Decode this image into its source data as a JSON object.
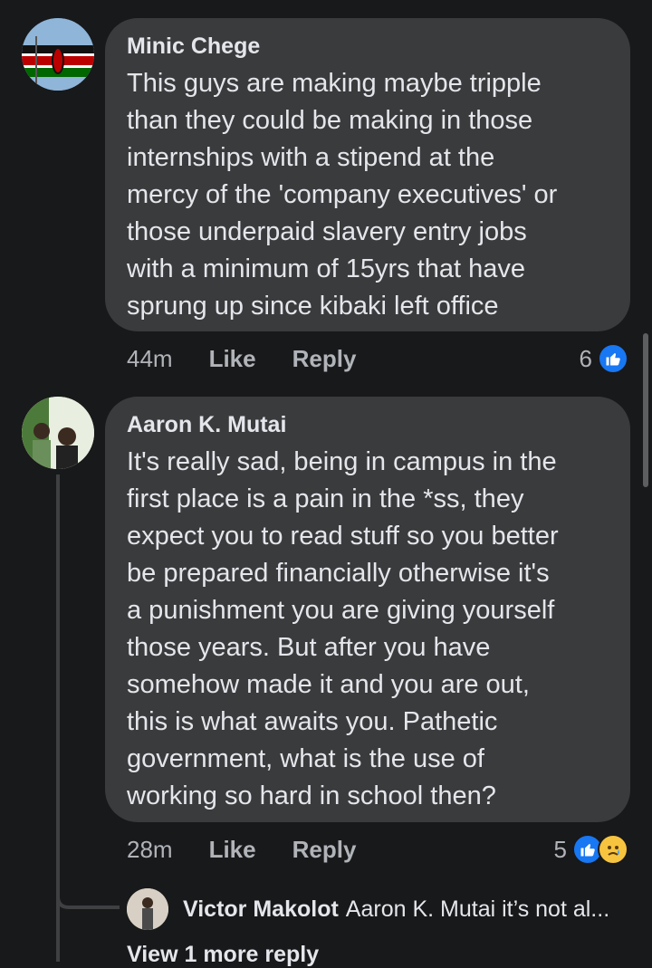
{
  "comments": [
    {
      "author": "Minic Chege",
      "text": "This guys are making maybe tripple\nthan they could be making in those\ninternships with a stipend at the\nmercy of the 'company executives' or\nthose underpaid slavery entry jobs\nwith a minimum of 15yrs that have\nsprung up since kibaki left office",
      "time": "44m",
      "like_label": "Like",
      "reply_label": "Reply",
      "reaction_count": "6",
      "reactions": [
        "like-icon"
      ]
    },
    {
      "author": "Aaron K. Mutai",
      "text": "It's really sad, being in campus in the\nfirst place is a pain in the  *ss, they\nexpect you to read stuff so you better\nbe prepared financially otherwise it's\na punishment you are giving yourself\nthose years. But after you have\nsomehow made it and you are out,\nthis is what awaits you. Pathetic\ngovernment, what is the use of\nworking so hard in school then?",
      "time": "28m",
      "like_label": "Like",
      "reply_label": "Reply",
      "reaction_count": "5",
      "reactions": [
        "like-icon",
        "sad-icon"
      ]
    }
  ],
  "reply_preview": {
    "name": "Victor Makolot",
    "snippet": "Aaron K. Mutai it’s not al..."
  },
  "view_more_label": "View 1 more reply",
  "colors": {
    "background": "#18191a",
    "bubble": "#3a3b3c",
    "accent": "#1877f2",
    "secondary_text": "#b0b3b8"
  }
}
